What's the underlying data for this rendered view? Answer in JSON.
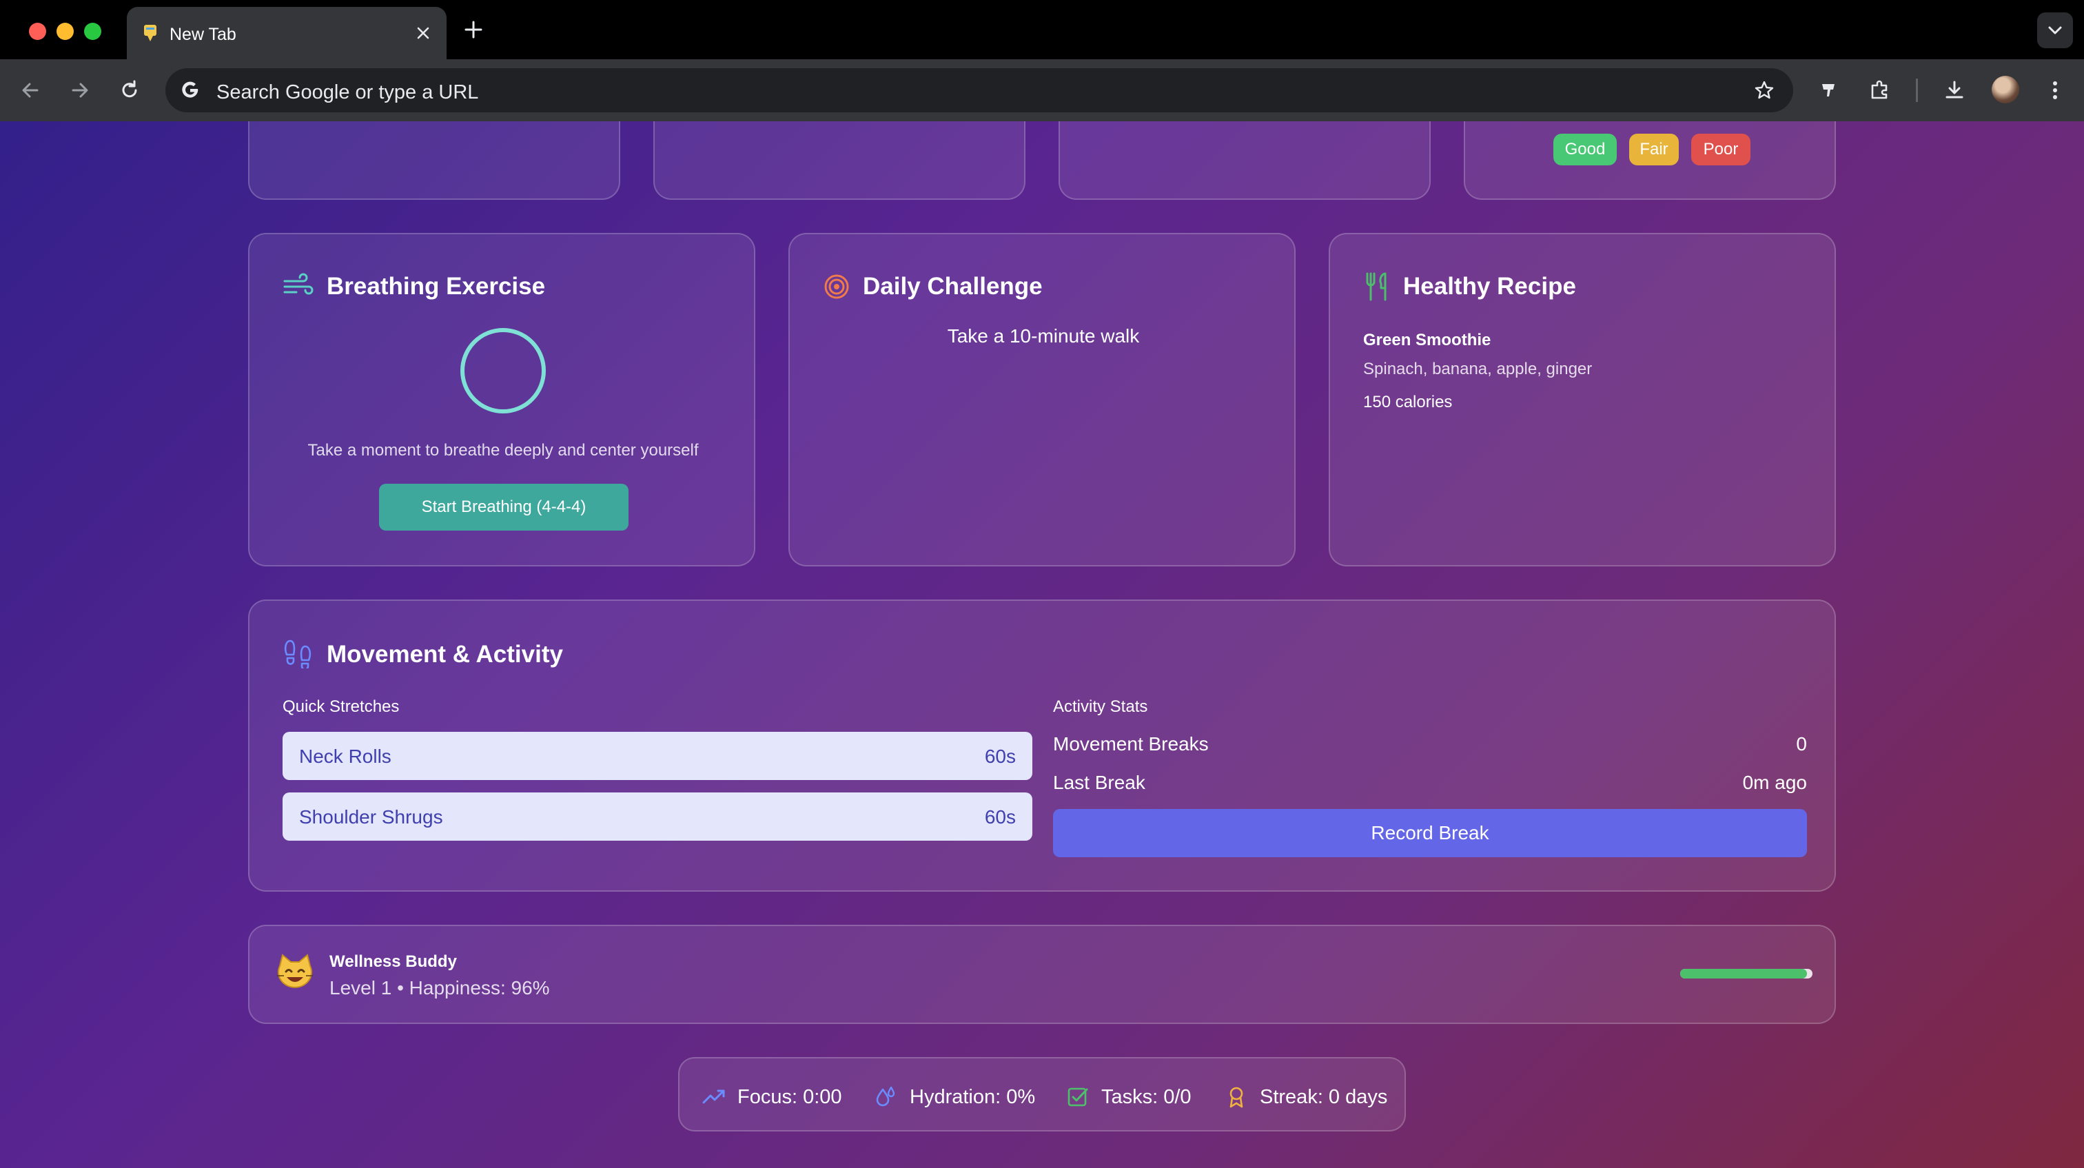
{
  "browser": {
    "tab_title": "New Tab",
    "omnibox_placeholder": "Search Google or type a URL",
    "icons": [
      "close-icon",
      "plus-icon",
      "chevron-down-icon",
      "back-arrow-icon",
      "forward-arrow-icon",
      "reload-icon",
      "google-g-icon",
      "star-icon",
      "extension-puzzle-icon",
      "download-icon",
      "kebab-menu-icon"
    ]
  },
  "colors": {
    "accent_indigo": "#6366e6",
    "accent_teal": "#3fa89d",
    "good": "#48c774",
    "fair": "#e8b43a",
    "poor": "#e0514d"
  },
  "posture": {
    "options": [
      "Good",
      "Fair",
      "Poor"
    ]
  },
  "breathing": {
    "title": "Breathing Exercise",
    "prompt": "Take a moment to breathe deeply and center yourself",
    "button": "Start Breathing (4-4-4)"
  },
  "challenge": {
    "title": "Daily Challenge",
    "text": "Take a 10-minute walk"
  },
  "recipe": {
    "title": "Healthy Recipe",
    "name": "Green Smoothie",
    "ingredients": "Spinach, banana, apple, ginger",
    "calories": "150 calories"
  },
  "movement": {
    "title": "Movement & Activity",
    "stretches_label": "Quick Stretches",
    "stretches": [
      {
        "name": "Neck Rolls",
        "duration": "60s"
      },
      {
        "name": "Shoulder Shrugs",
        "duration": "60s"
      }
    ],
    "stats_label": "Activity Stats",
    "stats": [
      {
        "label": "Movement Breaks",
        "value": "0"
      },
      {
        "label": "Last Break",
        "value": "0m ago"
      }
    ],
    "record_button": "Record Break"
  },
  "buddy": {
    "name": "Wellness Buddy",
    "status": "Level 1 • Happiness: 96%",
    "happiness": 0.96
  },
  "status_bar": {
    "focus": "Focus: 0:00",
    "hydration": "Hydration: 0%",
    "tasks": "Tasks: 0/0",
    "streak": "Streak: 0 days"
  }
}
